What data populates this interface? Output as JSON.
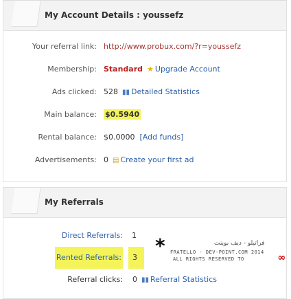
{
  "account": {
    "title": "My Account Details : youssefz",
    "rows": {
      "referral_link_label": "Your referral link:",
      "referral_link_value": "http://www.probux.com/?r=youssefz",
      "membership_label": "Membership:",
      "membership_value": "Standard",
      "upgrade_label": "Upgrade Account",
      "ads_clicked_label": "Ads clicked:",
      "ads_clicked_value": "528",
      "detailed_stats_label": "Detailed Statistics",
      "main_balance_label": "Main balance:",
      "main_balance_value": "$0.5940",
      "rental_balance_label": "Rental balance:",
      "rental_balance_value": "$0.0000",
      "add_funds_label": "[Add funds]",
      "advertisements_label": "Advertisements:",
      "advertisements_value": "0",
      "create_ad_label": "Create your first ad"
    }
  },
  "referrals": {
    "title": "My Referrals",
    "direct_label": "Direct Referrals:",
    "direct_value": "1",
    "rented_label": "Rented Referrals:",
    "rented_value": "3",
    "clicks_label": "Referral clicks:",
    "clicks_value": "0",
    "stats_label": "Referral Statistics"
  },
  "watermark": {
    "arabic": "فراتيلو - ديف بوينت",
    "line1": "FRATELLO - DEV-POINT.COM 2014",
    "line2": "ALL RIGHTS RESERVED TO"
  },
  "colors": {
    "highlight": "#f4f45a",
    "link_blue": "#2b5fa8",
    "link_red": "#a33333",
    "membership_red": "#bb2222"
  },
  "icons": {
    "upgrade": "star-icon",
    "stats": "bar-chart-icon",
    "create_ad": "ad-icon",
    "referral_stats": "bar-chart-icon"
  }
}
